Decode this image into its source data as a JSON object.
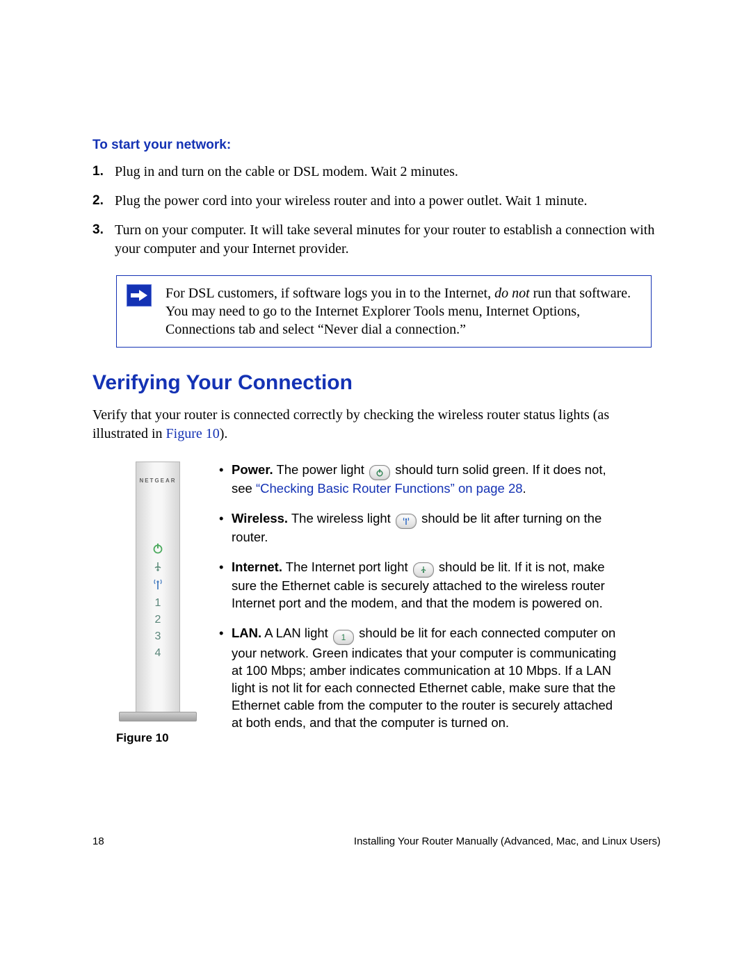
{
  "startNetwork": {
    "heading": "To start your network:",
    "steps": [
      "Plug in and turn on the cable or DSL modem. Wait 2 minutes.",
      "Plug the power cord into your wireless router and into a power outlet. Wait 1 minute.",
      "Turn on your computer. It will take several minutes for your router to establish a connection with your computer and your Internet provider."
    ]
  },
  "callout": {
    "pre": "For DSL customers, if software logs you in to the Internet, ",
    "em": "do not",
    "post": " run that software. You may need to go to the Internet Explorer Tools menu, Internet Options, Connections tab and select “Never dial a connection.”"
  },
  "section": {
    "title": "Verifying Your Connection",
    "intro_pre": "Verify that your router is connected correctly by checking the wireless router status lights (as illustrated in ",
    "intro_link": "Figure 10",
    "intro_post": ")."
  },
  "router": {
    "brand": "NETGEAR",
    "labels": [
      "1",
      "2",
      "3",
      "4"
    ]
  },
  "bullets": {
    "power": {
      "label": "Power.",
      "t1": " The power light ",
      "t2": " should turn solid green. If it does not, see ",
      "link": "“Checking Basic Router Functions” on page 28",
      "t3": "."
    },
    "wireless": {
      "label": "Wireless.",
      "t1": " The wireless light ",
      "t2": " should be lit after turning on the router."
    },
    "internet": {
      "label": "Internet.",
      "t1": " The Internet port light ",
      "t2": " should be lit. If it is not, make sure the Ethernet cable is securely attached to the wireless router Internet port and the modem, and that the modem is powered on."
    },
    "lan": {
      "label": "LAN.",
      "t1": " A LAN light ",
      "pillText": "1",
      "t2": " should be lit for each connected computer on your network. Green indicates that your computer is communicating at 100 Mbps; amber indicates communication at 10 Mbps. If a LAN light is not lit for each connected Ethernet cable, make sure that the Ethernet cable from the computer to the router is securely attached at both ends, and that the computer is turned on."
    }
  },
  "figureCaption": "Figure 10",
  "footer": {
    "page": "18",
    "chapter": "Installing Your Router Manually (Advanced, Mac, and Linux Users)"
  }
}
